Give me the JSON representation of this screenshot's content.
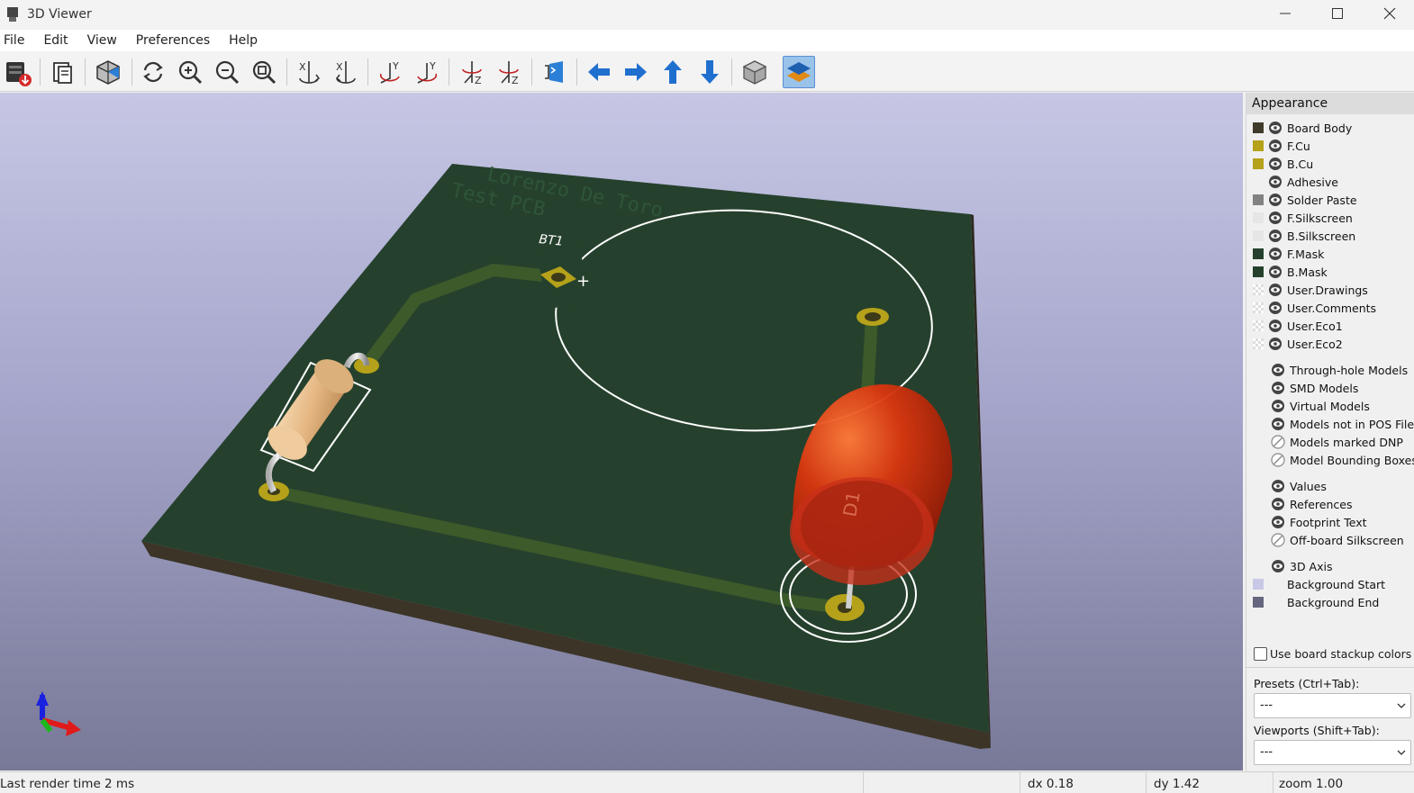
{
  "window": {
    "title": "3D Viewer",
    "controls": [
      "minimize-icon",
      "maximize-icon",
      "close-icon"
    ]
  },
  "menubar": {
    "items": [
      "File",
      "Edit",
      "View",
      "Preferences",
      "Help"
    ]
  },
  "toolbar": {
    "buttons": [
      {
        "icon": "export-image-icon"
      },
      {
        "icon": "copy-clipboard-icon"
      },
      {
        "icon": "raytracing-icon"
      },
      {
        "icon": "reload-icon"
      },
      {
        "icon": "zoom-in-icon"
      },
      {
        "icon": "zoom-out-icon"
      },
      {
        "icon": "zoom-fit-icon"
      },
      {
        "icon": "rotate-x-cw-icon"
      },
      {
        "icon": "rotate-x-ccw-icon"
      },
      {
        "icon": "rotate-y-cw-icon"
      },
      {
        "icon": "rotate-y-ccw-icon"
      },
      {
        "icon": "rotate-z-cw-icon"
      },
      {
        "icon": "rotate-z-ccw-icon"
      },
      {
        "icon": "flip-board-icon"
      },
      {
        "icon": "pan-left-icon"
      },
      {
        "icon": "pan-right-icon"
      },
      {
        "icon": "pan-up-icon"
      },
      {
        "icon": "pan-down-icon"
      },
      {
        "icon": "orthographic-icon"
      },
      {
        "icon": "layers-manager-icon",
        "active": true
      }
    ]
  },
  "scene": {
    "board_text_line1": "Lorenzo De Toro",
    "board_text_line2": "Test PCB",
    "battery_ref": "BT1",
    "battery_polarity": "+",
    "led_ref": "D1",
    "colors": {
      "board": "#25412d",
      "board_edge": "#3b3427",
      "copper": "#b5a11a",
      "silkscreen": "#ffffff",
      "led": "#c82c10",
      "resistor": "#e9be8c"
    }
  },
  "appearance": {
    "title": "Appearance",
    "layers": [
      {
        "label": "Board Body",
        "color": "#3f3a2a",
        "eye": true
      },
      {
        "label": "F.Cu",
        "color": "#b5a11a",
        "eye": true
      },
      {
        "label": "B.Cu",
        "color": "#b5a11a",
        "eye": true
      },
      {
        "label": "Adhesive",
        "color": "",
        "eye": true
      },
      {
        "label": "Solder Paste",
        "color": "#828282",
        "eye": true
      },
      {
        "label": "F.Silkscreen",
        "color": "#e6e6e6",
        "eye": true
      },
      {
        "label": "B.Silkscreen",
        "color": "#e6e6e6",
        "eye": true
      },
      {
        "label": "F.Mask",
        "color": "#25412d",
        "eye": true
      },
      {
        "label": "B.Mask",
        "color": "#25412d",
        "eye": true
      },
      {
        "label": "User.Drawings",
        "color": "checker",
        "eye": true
      },
      {
        "label": "User.Comments",
        "color": "checker",
        "eye": true
      },
      {
        "label": "User.Eco1",
        "color": "checker",
        "eye": true
      },
      {
        "label": "User.Eco2",
        "color": "checker",
        "eye": true
      }
    ],
    "models": [
      {
        "label": "Through-hole Models",
        "visible": true
      },
      {
        "label": "SMD Models",
        "visible": true
      },
      {
        "label": "Virtual Models",
        "visible": true
      },
      {
        "label": "Models not in POS File",
        "visible": true
      },
      {
        "label": "Models marked DNP",
        "visible": false
      },
      {
        "label": "Model Bounding Boxes",
        "visible": false
      }
    ],
    "texts": [
      {
        "label": "Values",
        "visible": true
      },
      {
        "label": "References",
        "visible": true
      },
      {
        "label": "Footprint Text",
        "visible": true
      },
      {
        "label": "Off-board Silkscreen",
        "visible": false
      }
    ],
    "misc": [
      {
        "label": "3D Axis",
        "visible": true
      }
    ],
    "background": [
      {
        "label": "Background Start",
        "color": "#c8c8e6"
      },
      {
        "label": "Background End",
        "color": "#666680"
      }
    ],
    "stackup_checkbox": {
      "label": "Use board stackup colors",
      "checked": false
    },
    "presets": {
      "label": "Presets (Ctrl+Tab):",
      "value": "---"
    },
    "viewports": {
      "label": "Viewports (Shift+Tab):",
      "value": "---"
    }
  },
  "statusbar": {
    "render_time": "Last render time 2 ms",
    "dx": "dx 0.18",
    "dy": "dy 1.42",
    "zoom": "zoom 1.00"
  }
}
